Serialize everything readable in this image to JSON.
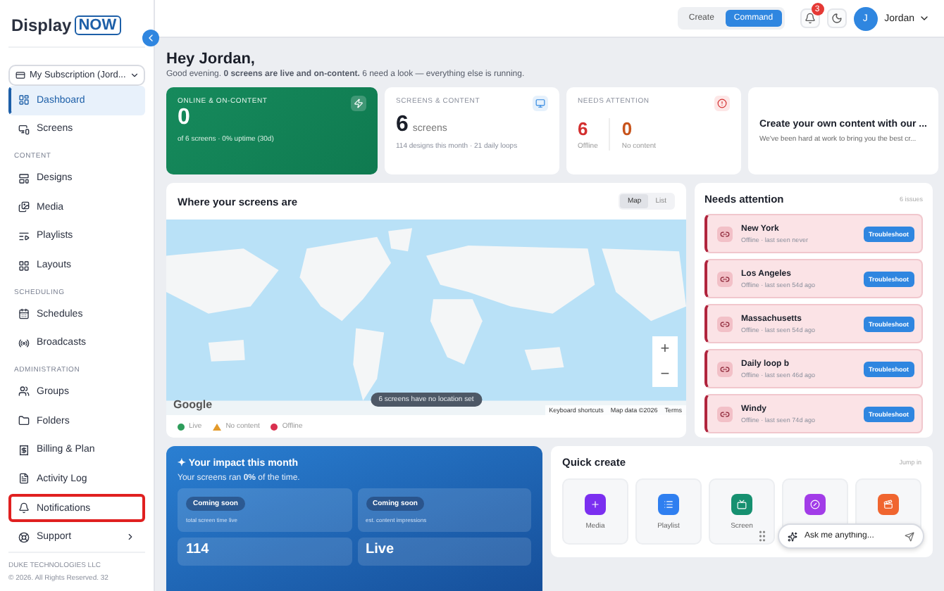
{
  "sidebar": {
    "logo": {
      "word": "Display",
      "badge": "NOW"
    },
    "subscription": "My Subscription (Jord...",
    "sections": [
      {
        "items": [
          {
            "label": "Dashboard",
            "selected": true,
            "highlighted": false
          },
          {
            "label": "Screens",
            "selected": false,
            "highlighted": false
          }
        ]
      },
      {
        "heading": "CONTENT",
        "items": [
          {
            "label": "Designs",
            "selected": false,
            "highlighted": false
          },
          {
            "label": "Media",
            "selected": false,
            "highlighted": false
          },
          {
            "label": "Playlists",
            "selected": false,
            "highlighted": false
          },
          {
            "label": "Layouts",
            "selected": false,
            "highlighted": false
          }
        ]
      },
      {
        "heading": "SCHEDULING",
        "items": [
          {
            "label": "Schedules",
            "selected": false,
            "highlighted": false
          },
          {
            "label": "Broadcasts",
            "selected": false,
            "highlighted": false
          }
        ]
      },
      {
        "heading": "ADMINISTRATION",
        "items": [
          {
            "label": "Groups",
            "selected": false,
            "highlighted": false
          },
          {
            "label": "Folders",
            "selected": false,
            "highlighted": false
          },
          {
            "label": "Billing & Plan",
            "selected": false,
            "highlighted": false
          },
          {
            "label": "Activity Log",
            "selected": false,
            "highlighted": false
          },
          {
            "label": "Notifications",
            "selected": false,
            "highlighted": true
          },
          {
            "label": "Support",
            "selected": false,
            "highlighted": false,
            "submenu": true
          }
        ]
      }
    ],
    "footer": [
      "DUKE TECHNOLOGIES LLC",
      "© 2026. All Rights Reserved. 32"
    ]
  },
  "topbar": {
    "modes": [
      {
        "label": "Create",
        "selected": false
      },
      {
        "label": "Command",
        "selected": true
      }
    ],
    "notification_count": "3",
    "avatar": "J",
    "user": "Jordan"
  },
  "greeting": {
    "title": "Hey Jordan,",
    "subtitle": "Good evening. **0 screens are live and on-content.** 6 need a look — everything else is running."
  },
  "stats": [
    {
      "kind": "hero",
      "label": "ONLINE & ON-CONTENT",
      "value": "0",
      "note": "of 6 screens · 0% uptime (30d)"
    },
    {
      "kind": "count",
      "label": "SCREENS & CONTENT",
      "value": "6",
      "unit": "screens",
      "note": "114 designs this month · 21 daily loops"
    },
    {
      "kind": "split",
      "label": "NEEDS ATTENTION",
      "parts": [
        {
          "value": "6",
          "caption": "Offline",
          "color": "#d32f2f"
        },
        {
          "value": "0",
          "caption": "No content",
          "color": "#c8541c"
        }
      ]
    },
    {
      "kind": "promo",
      "title": "Create your own content with our ...",
      "text": "We've been hard at work to bring you the best cr..."
    }
  ],
  "map": {
    "title": "Where your screens are",
    "views": [
      {
        "label": "Map",
        "selected": true
      },
      {
        "label": "List",
        "selected": false
      }
    ],
    "notice": "6 screens have no location set",
    "brand": "Google",
    "attribution": [
      "Keyboard shortcuts",
      "Map data ©2026",
      "Terms"
    ],
    "zoom": [
      "+",
      "−"
    ],
    "legend": [
      {
        "label": "Live",
        "kind": "dot",
        "color": "#2e9d5b"
      },
      {
        "label": "No content",
        "kind": "triangle",
        "color": "#e39a2b"
      },
      {
        "label": "Offline",
        "kind": "dot",
        "color": "#d9304f"
      }
    ]
  },
  "attention": {
    "title": "Needs attention",
    "count": "6 issues",
    "items": [
      {
        "name": "New York",
        "status": "Offline · last seen never",
        "action": "Troubleshoot"
      },
      {
        "name": "Los Angeles",
        "status": "Offline · last seen 54d ago",
        "action": "Troubleshoot"
      },
      {
        "name": "Massachusetts",
        "status": "Offline · last seen 54d ago",
        "action": "Troubleshoot"
      },
      {
        "name": "Daily loop b",
        "status": "Offline · last seen 46d ago",
        "action": "Troubleshoot"
      },
      {
        "name": "Windy",
        "status": "Offline · last seen 74d ago",
        "action": "Troubleshoot"
      }
    ]
  },
  "impact": {
    "title": "✦ Your impact this month",
    "text": "Your screens ran **0%** of the time.",
    "tiles": [
      {
        "badge": "Coming soon",
        "caption": "total screen time live"
      },
      {
        "badge": "Coming soon",
        "caption": "est. content impressions"
      }
    ],
    "values": [
      "114",
      "Live"
    ]
  },
  "quick_create": {
    "title": "Quick create",
    "hint": "Jump in",
    "tiles": [
      {
        "label": "Media",
        "color": "#7b2ff0"
      },
      {
        "label": "Playlist",
        "color": "#2f7ff0"
      },
      {
        "label": "Screen",
        "color": "#169070"
      },
      {
        "color": "#a23ce8"
      },
      {
        "color": "#f0652f"
      }
    ]
  },
  "assistant": {
    "placeholder": "Ask me anything..."
  }
}
